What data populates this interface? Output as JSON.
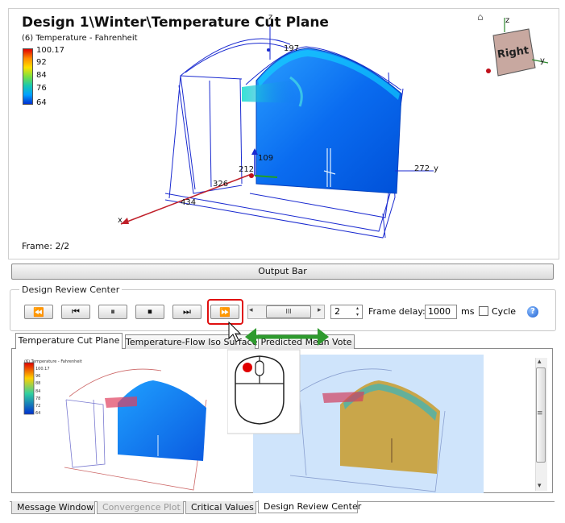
{
  "viewport": {
    "title": "Design 1\\Winter\\Temperature Cut Plane",
    "subtitle": "(6) Temperature - Fahrenheit",
    "legend_ticks": [
      "100.17",
      "92",
      "84",
      "76",
      "64"
    ],
    "frame": "Frame: 2/2",
    "coords": {
      "c197": "197",
      "c109": "109",
      "c212": "212",
      "c326": "326",
      "c434": "434",
      "c272": "272",
      "axis_y": "y",
      "axis_z": "z",
      "axis_x": "x"
    },
    "nav_cube": {
      "face_label": "Right",
      "axis_z": "z",
      "axis_y": "y"
    }
  },
  "output_bar": {
    "label": "Output Bar"
  },
  "design_review_center": {
    "legend": "Design Review Center",
    "frame_value": "2",
    "frame_delay_label": "Frame delay:",
    "frame_delay_value": "1000",
    "ms_label": "ms",
    "cycle_label": "Cycle",
    "cycle_checked": false,
    "help_glyph": "?",
    "slider_grip": "III"
  },
  "tabs": [
    {
      "label": "Temperature Cut Plane",
      "active": true
    },
    {
      "label": "Temperature-Flow Iso Surface",
      "active": false
    },
    {
      "label": "Predicted Mean Vote",
      "active": false
    }
  ],
  "thumbnail": {
    "subtitle": "(6) Temperature - Fahrenheit",
    "legend_ticks": [
      "100.17",
      "96",
      "88",
      "84",
      "78",
      "72",
      "64"
    ]
  },
  "bottom_tabs": [
    {
      "label": "Message Window",
      "disabled": false
    },
    {
      "label": "Convergence Plot",
      "disabled": true
    },
    {
      "label": "Critical Values",
      "disabled": false
    },
    {
      "label": "Design Review Center",
      "disabled": false,
      "active": true
    }
  ],
  "colors": {
    "highlight": "#e01010",
    "arrow_green": "#2e9a2e",
    "mouse_button": "#e00000",
    "plane_blue": "#0a6cf0"
  },
  "icons": {
    "rewind": "⏪",
    "step_back": "⏮",
    "pause": "⏸",
    "stop": "⏹",
    "step_forward": "⏭",
    "fast_forward": "⏩",
    "scroll_left": "◂",
    "scroll_right": "▸",
    "scroll_up": "▴",
    "scroll_down": "▾",
    "scroll_grip": "≡",
    "home": "⌂"
  }
}
